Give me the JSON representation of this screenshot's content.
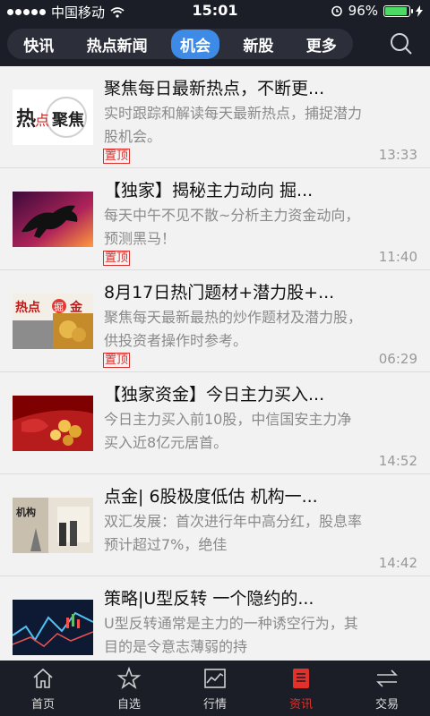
{
  "status": {
    "carrier": "中国移动",
    "time": "15:01",
    "battery": "96%",
    "battery_level": 0.96
  },
  "top_tabs": [
    {
      "label": "快讯",
      "active": false
    },
    {
      "label": "热点新闻",
      "active": false
    },
    {
      "label": "机会",
      "active": true
    },
    {
      "label": "新股",
      "active": false
    },
    {
      "label": "更多",
      "active": false
    }
  ],
  "news": [
    {
      "title": "聚焦每日最新热点，不断更...",
      "summary": "实时跟踪和解读每天最新热点，捕捉潜力股机会。",
      "pin": "置顶",
      "time": "13:33",
      "thumb_text": "热点聚焦"
    },
    {
      "title": "【独家】揭秘主力动向 掘...",
      "summary": "每天中午不见不散~分析主力资金动向，预测黑马！",
      "pin": "置顶",
      "time": "11:40",
      "thumb_text": ""
    },
    {
      "title": "8月17日热门题材+潜力股+...",
      "summary": "聚焦每天最新最热的炒作题材及潜力股，供投资者操作时参考。",
      "pin": "置顶",
      "time": "06:29",
      "thumb_text": "热点掘金"
    },
    {
      "title": "【独家资金】今日主力买入...",
      "summary": "今日主力买入前10股，中信国安主力净买入近8亿元居首。",
      "pin": "",
      "time": "14:52",
      "thumb_text": ""
    },
    {
      "title": "点金| 6股极度低估 机构一...",
      "summary": "双汇发展：首次进行年中高分红，股息率预计超过7%，绝佳",
      "pin": "",
      "time": "14:42",
      "thumb_text": "机构"
    },
    {
      "title": "策略|U型反转 一个隐约的...",
      "summary": "U型反转通常是主力的一种诱空行为，其目的是令意志薄弱的持",
      "pin": "",
      "time": "",
      "thumb_text": ""
    }
  ],
  "bottom_nav": [
    {
      "label": "首页",
      "icon": "home-icon",
      "active": false
    },
    {
      "label": "自选",
      "icon": "star-icon",
      "active": false
    },
    {
      "label": "行情",
      "icon": "chart-icon",
      "active": false
    },
    {
      "label": "资讯",
      "icon": "news-icon",
      "active": true
    },
    {
      "label": "交易",
      "icon": "transfer-icon",
      "active": false
    }
  ],
  "colors": {
    "accent": "#3d8be6",
    "active_nav": "#e0312b",
    "pin": "#d9302c"
  }
}
